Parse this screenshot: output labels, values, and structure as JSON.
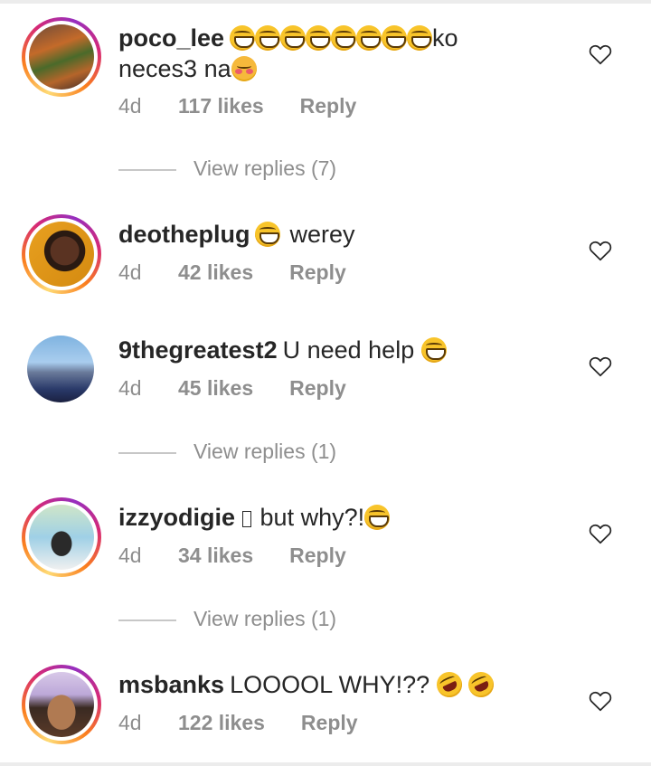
{
  "comments": [
    {
      "username": "poco_lee",
      "text_after": "ko neces3 na",
      "time": "4d",
      "likes": "117 likes",
      "reply": "Reply",
      "view_replies": "View replies (7)"
    },
    {
      "username": "deotheplug",
      "text_after": "werey",
      "time": "4d",
      "likes": "42 likes",
      "reply": "Reply"
    },
    {
      "username": "9thegreatest2",
      "text": "U need help",
      "time": "4d",
      "likes": "45 likes",
      "reply": "Reply",
      "view_replies": "View replies (1)"
    },
    {
      "username": "izzyodigie",
      "text": "but why?!",
      "time": "4d",
      "likes": "34 likes",
      "reply": "Reply",
      "view_replies": "View replies (1)"
    },
    {
      "username": "msbanks",
      "text": "LOOOOL WHY!??",
      "time": "4d",
      "likes": "122 likes",
      "reply": "Reply"
    }
  ],
  "icons": {
    "like": "heart-outline-icon",
    "emoji_grin": "grinning-squinting-face-emoji",
    "emoji_blush": "blushing-face-emoji",
    "emoji_rofl": "rolling-on-floor-laughing-emoji"
  },
  "colors": {
    "text": "#262626",
    "secondary": "#8e8e8e",
    "story_ring": "#d62976"
  }
}
